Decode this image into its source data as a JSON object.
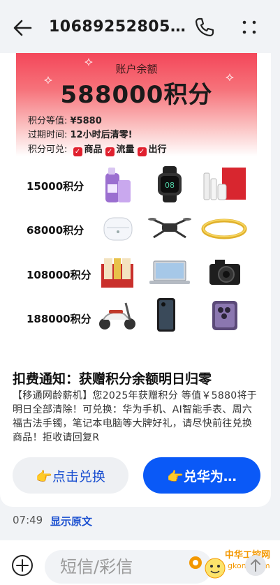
{
  "header": {
    "title": "10689252805…"
  },
  "banner": {
    "label": "账户余额",
    "amount": "588000积分",
    "equiv_label": "积分等值: ",
    "equiv_value": "¥5880",
    "expire_label": "过期时间: ",
    "expire_value": "12小时后清零!",
    "redeem_label": "积分可兑: ",
    "redeem_options": [
      "商品",
      "流量",
      "出行"
    ]
  },
  "tiers": [
    {
      "points": "15000积分",
      "items": [
        "laundry-detergent",
        "smartwatch",
        "skincare-set"
      ]
    },
    {
      "points": "68000积分",
      "items": [
        "earbuds",
        "drone",
        "gold-bracelet"
      ]
    },
    {
      "points": "108000积分",
      "items": [
        "liquor-giftbox",
        "laptop",
        "camera"
      ]
    },
    {
      "points": "188000积分",
      "items": [
        "electric-scooter",
        "phone",
        "phone-purple"
      ]
    }
  ],
  "notice": {
    "title": "扣费通知：获赠积分余额明日归零",
    "body": "【移通网龄薪机】您2025年获赠积分 等值￥5880将于明日全部清除！可兑换：华为手机、AI智能手表、周六福古法手镯，笔记本电脑等大牌好礼，请尽快前往兑换商品！拒收请回复R"
  },
  "actions": {
    "redeem_label": "👉点击兑换",
    "huawei_label": "👉兑华为…"
  },
  "meta": {
    "time": "07:49",
    "show_original": "显示原文"
  },
  "composer": {
    "placeholder": "短信/彩信"
  },
  "watermark": {
    "line1": "中华工控网",
    "line2": "gkong.com"
  },
  "colors": {
    "accent_blue": "#0a59f7",
    "banner_red": "#f4475a",
    "check_red": "#e0202e"
  }
}
